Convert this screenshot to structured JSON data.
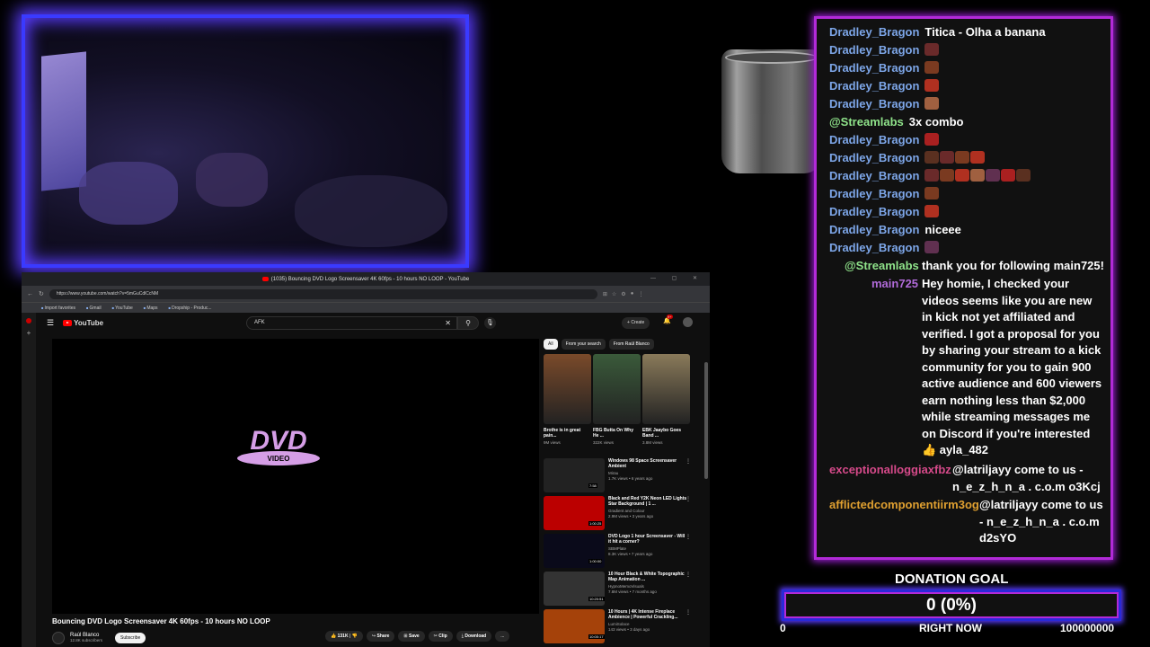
{
  "browser": {
    "tab_title": "(1035) Bouncing DVD Logo Screensaver 4K 60fps - 10 hours NO LOOP - YouTube",
    "url": "https://www.youtube.com/watch?v=5mGuCdlCcNM",
    "bookmarks": [
      "Import favorites",
      "Gmail",
      "YouTube",
      "Maps",
      "Dropship - Produc..."
    ]
  },
  "youtube": {
    "logo_text": "YouTube",
    "search_query": "AFK",
    "create_label": "Create",
    "notif_count": "9+",
    "video_title": "Bouncing DVD Logo Screensaver 4K 60fps - 10 hours NO LOOP",
    "channel_name": "Raúl Blanco",
    "subscribers": "12.8K subscribers",
    "subscribe_label": "Subscribe",
    "actions": [
      "131K",
      "Share",
      "Save",
      "Clip",
      "Download",
      "..."
    ],
    "chips": [
      "All",
      "From your search",
      "From Raúl Blanco"
    ],
    "shorts": [
      {
        "title": "Brothe is in great pain...",
        "views": "9M views",
        "color": "#7a4a2a"
      },
      {
        "title": "FBG Butta On Why He ...",
        "views": "322K views",
        "color": "#3a5a3a"
      },
      {
        "title": "EBK Jaaybo Goes Band ...",
        "views": "3.8M views",
        "color": "#8a7a5a"
      }
    ],
    "recommendations": [
      {
        "title": "Windows 98 Space Screensaver Ambient",
        "channel": "Mirau",
        "meta": "1.7K views • 6 years ago",
        "duration": "7:58",
        "color": "#222"
      },
      {
        "title": "Black and Red Y2K Neon LED Lights Star Background | 1 ...",
        "channel": "Gradient and Colour",
        "meta": "2.9M views • 3 years ago",
        "duration": "1:00:25",
        "color": "#b00"
      },
      {
        "title": "DVD Logo 1 hour Screensaver - Will it hit a corner?",
        "channel": "SBMPlate",
        "meta": "8.3K views • 7 years ago",
        "duration": "1:00:00",
        "color": "#0a0a1a"
      },
      {
        "title": "10 Hour Black & White Topographic Map Animation ...",
        "channel": "HypnoMemoVisuals",
        "meta": "7.8M views • 7 months ago",
        "duration": "10:20:51",
        "color": "#333"
      },
      {
        "title": "10 Hours | 4K Intense Fireplace Ambience | Powerful Crackling...",
        "channel": "LumiSolace",
        "meta": "143 views • 3 days ago",
        "duration": "10:00:17",
        "color": "#a5420a"
      }
    ],
    "dvd_text": "DVD",
    "dvd_sub": "VIDEO"
  },
  "chat": {
    "messages": [
      {
        "user": "Dradley_Bragon",
        "text": "Titica - Olha a banana",
        "color": "#7da6e8"
      },
      {
        "user": "Dradley_Bragon",
        "text": "",
        "color": "#7da6e8"
      },
      {
        "user": "Dradley_Bragon",
        "text": "",
        "color": "#7da6e8"
      },
      {
        "user": "Dradley_Bragon",
        "text": "",
        "color": "#7da6e8"
      },
      {
        "user": "Dradley_Bragon",
        "text": "",
        "color": "#7da6e8"
      },
      {
        "user": "@Streamlabs",
        "text": "3x   combo",
        "color": "#8fe38a"
      },
      {
        "user": "Dradley_Bragon",
        "text": "",
        "color": "#7da6e8"
      },
      {
        "user": "Dradley_Bragon",
        "text": "",
        "color": "#7da6e8"
      },
      {
        "user": "Dradley_Bragon",
        "text": "",
        "color": "#7da6e8"
      },
      {
        "user": "Dradley_Bragon",
        "text": "",
        "color": "#7da6e8"
      },
      {
        "user": "Dradley_Bragon",
        "text": "",
        "color": "#7da6e8"
      },
      {
        "user": "Dradley_Bragon",
        "text": "niceee",
        "color": "#7da6e8"
      },
      {
        "user": "Dradley_Bragon",
        "text": "",
        "color": "#7da6e8"
      }
    ],
    "follow_user": "@Streamlabs",
    "follow_text": "thank you for following main725!",
    "main_user": "main725",
    "main_lines": [
      "Hey homie, I checked your",
      "videos seems like you are new",
      "in kick not yet affiliated and",
      "verified. I got a proposal for you",
      "by sharing your stream to a kick",
      "community for you to gain 900",
      "active audience and 600 viewers",
      "earn nothing less than $2,000",
      "while streaming messages me",
      "on Discord if you're interested",
      "👍 ayla_482"
    ],
    "spam1_user": "exceptionalloggiaxfbz",
    "spam1_lines": [
      "@latriljayy come to us -",
      "n_e_z_h_n_a . c.o.m o3Kcj"
    ],
    "spam2_user": "afflictedcomponentiirm3og",
    "spam2_lines": [
      "@latriljayy come to us",
      "- n_e_z_h_n_a . c.o.m",
      "d2sYO"
    ],
    "colors": {
      "user_blue": "#7da6e8",
      "streamlabs": "#8fe38a",
      "main725": "#b06ad8",
      "spam1": "#d64a8a",
      "spam2": "#e0a030"
    }
  },
  "donation": {
    "title": "DONATION GOAL",
    "value": "0 (0%)",
    "progress": 0,
    "min": "0",
    "label": "RIGHT NOW",
    "max": "100000000"
  }
}
